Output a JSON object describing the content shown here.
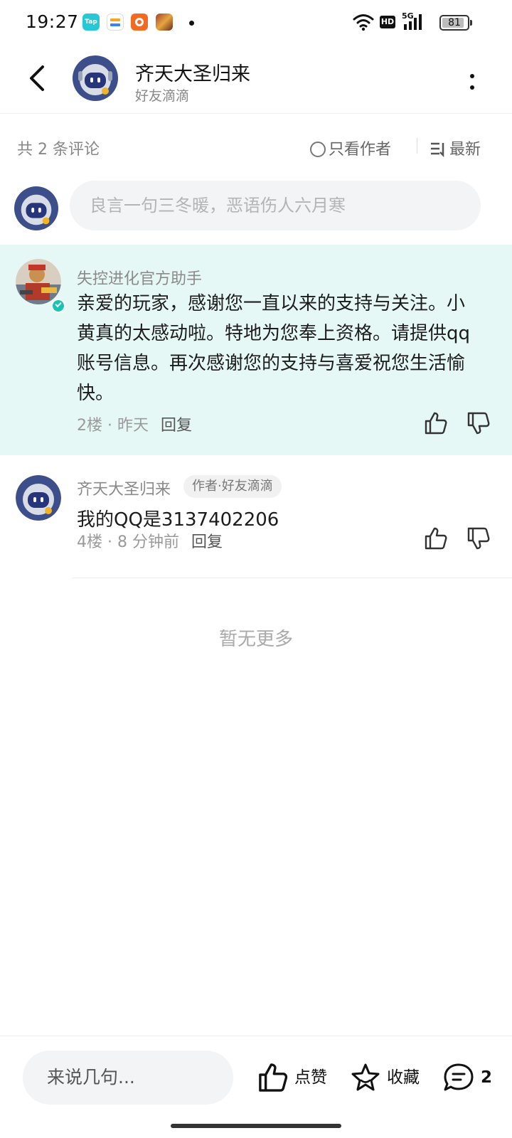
{
  "status_bar": {
    "time": "19:27",
    "network": "5G",
    "hd": "HD",
    "battery": "81",
    "app_icon_label": "Tap"
  },
  "header": {
    "title": "齐天大圣归来",
    "subtitle": "好友滴滴"
  },
  "comments_bar": {
    "count_text": "共 2 条评论",
    "author_only": "只看作者",
    "sort_label": "最新"
  },
  "comment_input": {
    "placeholder": "良言一句三冬暖，恶语伤人六月寒"
  },
  "comments": [
    {
      "author": "失控进化官方助手",
      "verified": true,
      "text": "亲爱的玩家，感谢您一直以来的支持与关注。小黄真的太感动啦。特地为您奉上资格。请提供qq账号信息。再次感谢您的支持与喜爱祝您生活愉快。",
      "meta": "2楼 · 昨天",
      "reply_label": "回复",
      "highlight_color": "#e6f8f6"
    },
    {
      "author": "齐天大圣归来",
      "tag": "作者·好友滴滴",
      "text": "我的QQ是3137402206",
      "meta": "4楼 · 8 分钟前",
      "reply_label": "回复"
    }
  ],
  "no_more": "暂无更多",
  "bottom_bar": {
    "input_placeholder": "来说几句...",
    "like_label": "点赞",
    "favorite_label": "收藏",
    "comment_count": "2"
  },
  "colors": {
    "accent": "#17c4b5",
    "highlight": "#e6f8f6"
  }
}
